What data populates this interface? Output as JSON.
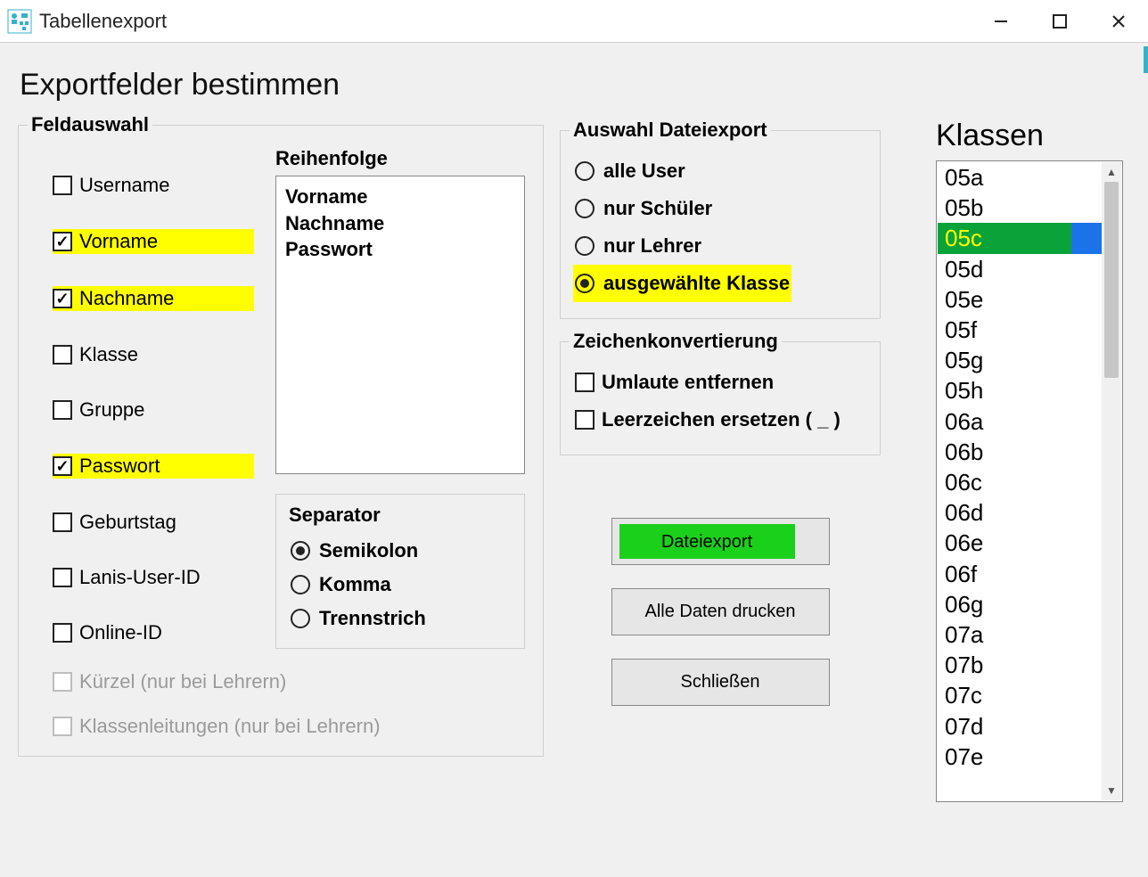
{
  "window": {
    "title": "Tabellenexport"
  },
  "page_heading": "Exportfelder bestimmen",
  "feldauswahl": {
    "legend": "Feldauswahl",
    "fields": [
      {
        "label": "Username",
        "checked": false,
        "highlight": false,
        "disabled": false
      },
      {
        "label": "Vorname",
        "checked": true,
        "highlight": true,
        "disabled": false
      },
      {
        "label": "Nachname",
        "checked": true,
        "highlight": true,
        "disabled": false
      },
      {
        "label": "Klasse",
        "checked": false,
        "highlight": false,
        "disabled": false
      },
      {
        "label": "Gruppe",
        "checked": false,
        "highlight": false,
        "disabled": false
      },
      {
        "label": "Passwort",
        "checked": true,
        "highlight": true,
        "disabled": false
      },
      {
        "label": "Geburtstag",
        "checked": false,
        "highlight": false,
        "disabled": false
      },
      {
        "label": "Lanis-User-ID",
        "checked": false,
        "highlight": false,
        "disabled": false
      },
      {
        "label": "Online-ID",
        "checked": false,
        "highlight": false,
        "disabled": false
      },
      {
        "label": "Kürzel (nur bei Lehrern)",
        "checked": false,
        "highlight": false,
        "disabled": true
      },
      {
        "label": "Klassenleitungen (nur bei Lehrern)",
        "checked": false,
        "highlight": false,
        "disabled": true
      }
    ]
  },
  "reihenfolge": {
    "label": "Reihenfolge",
    "items": [
      "Vorname",
      "Nachname",
      "Passwort"
    ]
  },
  "separator": {
    "legend": "Separator",
    "options": [
      {
        "label": "Semikolon",
        "selected": true
      },
      {
        "label": "Komma",
        "selected": false
      },
      {
        "label": "Trennstrich",
        "selected": false
      }
    ]
  },
  "dateiexport": {
    "legend": "Auswahl Dateiexport",
    "options": [
      {
        "label": "alle User",
        "selected": false,
        "highlight": false
      },
      {
        "label": "nur Schüler",
        "selected": false,
        "highlight": false
      },
      {
        "label": "nur Lehrer",
        "selected": false,
        "highlight": false
      },
      {
        "label": "ausgewählte Klasse",
        "selected": true,
        "highlight": true
      }
    ]
  },
  "zeichen": {
    "legend": "Zeichenkonvertierung",
    "options": [
      {
        "label": "Umlaute entfernen",
        "checked": false
      },
      {
        "label": "Leerzeichen ersetzen ( _ )",
        "checked": false
      }
    ]
  },
  "buttons": {
    "export": "Dateiexport",
    "print": "Alle Daten drucken",
    "close": "Schließen"
  },
  "klassen": {
    "heading": "Klassen",
    "items": [
      "05a",
      "05b",
      "05c",
      "05d",
      "05e",
      "05f",
      "05g",
      "05h",
      "06a",
      "06b",
      "06c",
      "06d",
      "06e",
      "06f",
      "06g",
      "07a",
      "07b",
      "07c",
      "07d",
      "07e"
    ],
    "selected_index": 2
  }
}
